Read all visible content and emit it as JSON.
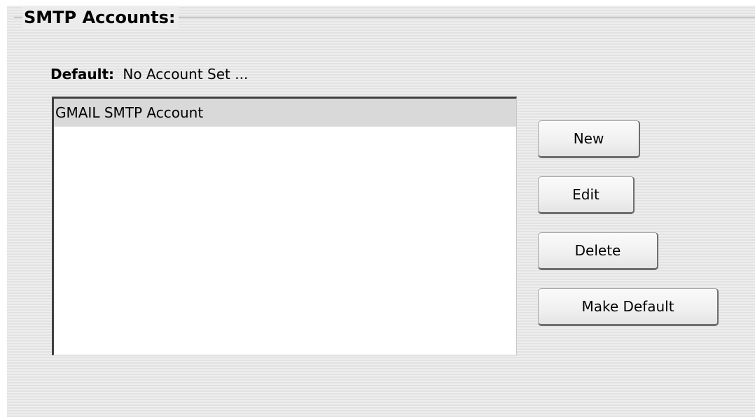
{
  "group": {
    "title": "SMTP Accounts:"
  },
  "default_account": {
    "label": "Default:",
    "value": "No Account Set ..."
  },
  "accounts_list": {
    "items": [
      {
        "label": "GMAIL SMTP Account",
        "selected": true
      }
    ]
  },
  "buttons": {
    "new_label": "New",
    "edit_label": "Edit",
    "delete_label": "Delete",
    "make_default_label": "Make Default"
  }
}
